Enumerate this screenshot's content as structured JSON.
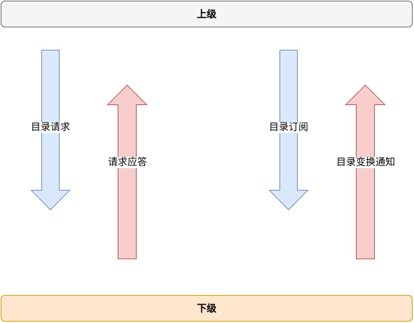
{
  "top_box": {
    "label": "上级"
  },
  "bottom_box": {
    "label": "下级"
  },
  "arrows": [
    {
      "id": "down-1",
      "label": "目录请求",
      "direction": "down"
    },
    {
      "id": "up-1",
      "label": "请求应答",
      "direction": "up"
    },
    {
      "id": "down-2",
      "label": "目录订阅",
      "direction": "down"
    },
    {
      "id": "up-2",
      "label": "目录变换通知",
      "direction": "up"
    }
  ],
  "colors": {
    "down_fill": "#dae8fc",
    "down_stroke": "#6c8ebf",
    "up_fill": "#f8cecc",
    "up_stroke": "#b85450",
    "top_fill": "#f5f5f5",
    "top_stroke": "#666666",
    "bottom_fill": "#ffe6cc",
    "bottom_stroke": "#d79b00"
  }
}
